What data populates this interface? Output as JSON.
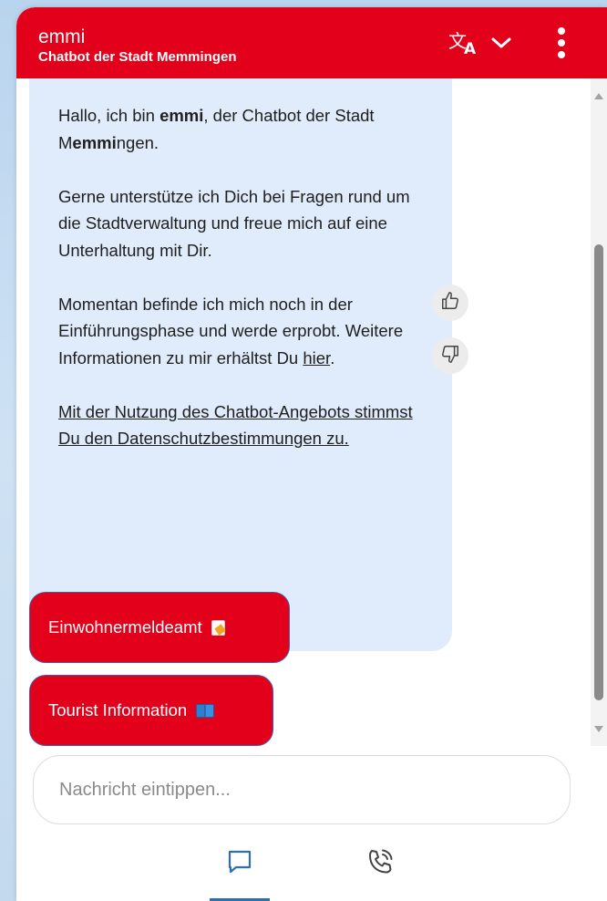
{
  "header": {
    "title": "emmi",
    "subtitle": "Chatbot der Stadt Memmingen",
    "translate_icon": "translate-icon",
    "chevron_icon": "chevron-down-icon",
    "menu_icon": "more-vertical-icon",
    "background_color": "#e2001a"
  },
  "message": {
    "p1_before": "Hallo, ich bin ",
    "p1_bold": "emmi",
    "p1_mid": ", der Chatbot der Stadt M",
    "p1_bold2": "emmi",
    "p1_after": "ngen.",
    "p2": "Gerne unterstütze ich Dich bei Fragen rund um die Stadtverwaltung und freue mich auf eine Unterhaltung mit Dir.",
    "p3_before": "Momentan befinde ich mich noch in der Einführungsphase und werde erprobt. Weitere Informationen zu mir erhältst Du ",
    "p3_link": "hier",
    "p3_after": ".",
    "p4_link": "Mit der Nutzung des Chatbot-Angebots stimmst Du den Datenschutzbestimmungen zu.",
    "bubble_color": "#e0ebfc"
  },
  "feedback": {
    "like_icon": "thumbs-up-icon",
    "dislike_icon": "thumbs-down-icon"
  },
  "quick_replies": [
    {
      "label": "Einwohnermeldeamt",
      "icon": "memo-emoji-icon"
    },
    {
      "label": "Tourist Information",
      "icon": "book-emoji-icon"
    }
  ],
  "input": {
    "placeholder": "Nachricht eintippen..."
  },
  "bottom_nav": {
    "chat_icon": "chat-bubble-icon",
    "call_icon": "phone-call-icon",
    "active_color": "#2c6fb7"
  }
}
